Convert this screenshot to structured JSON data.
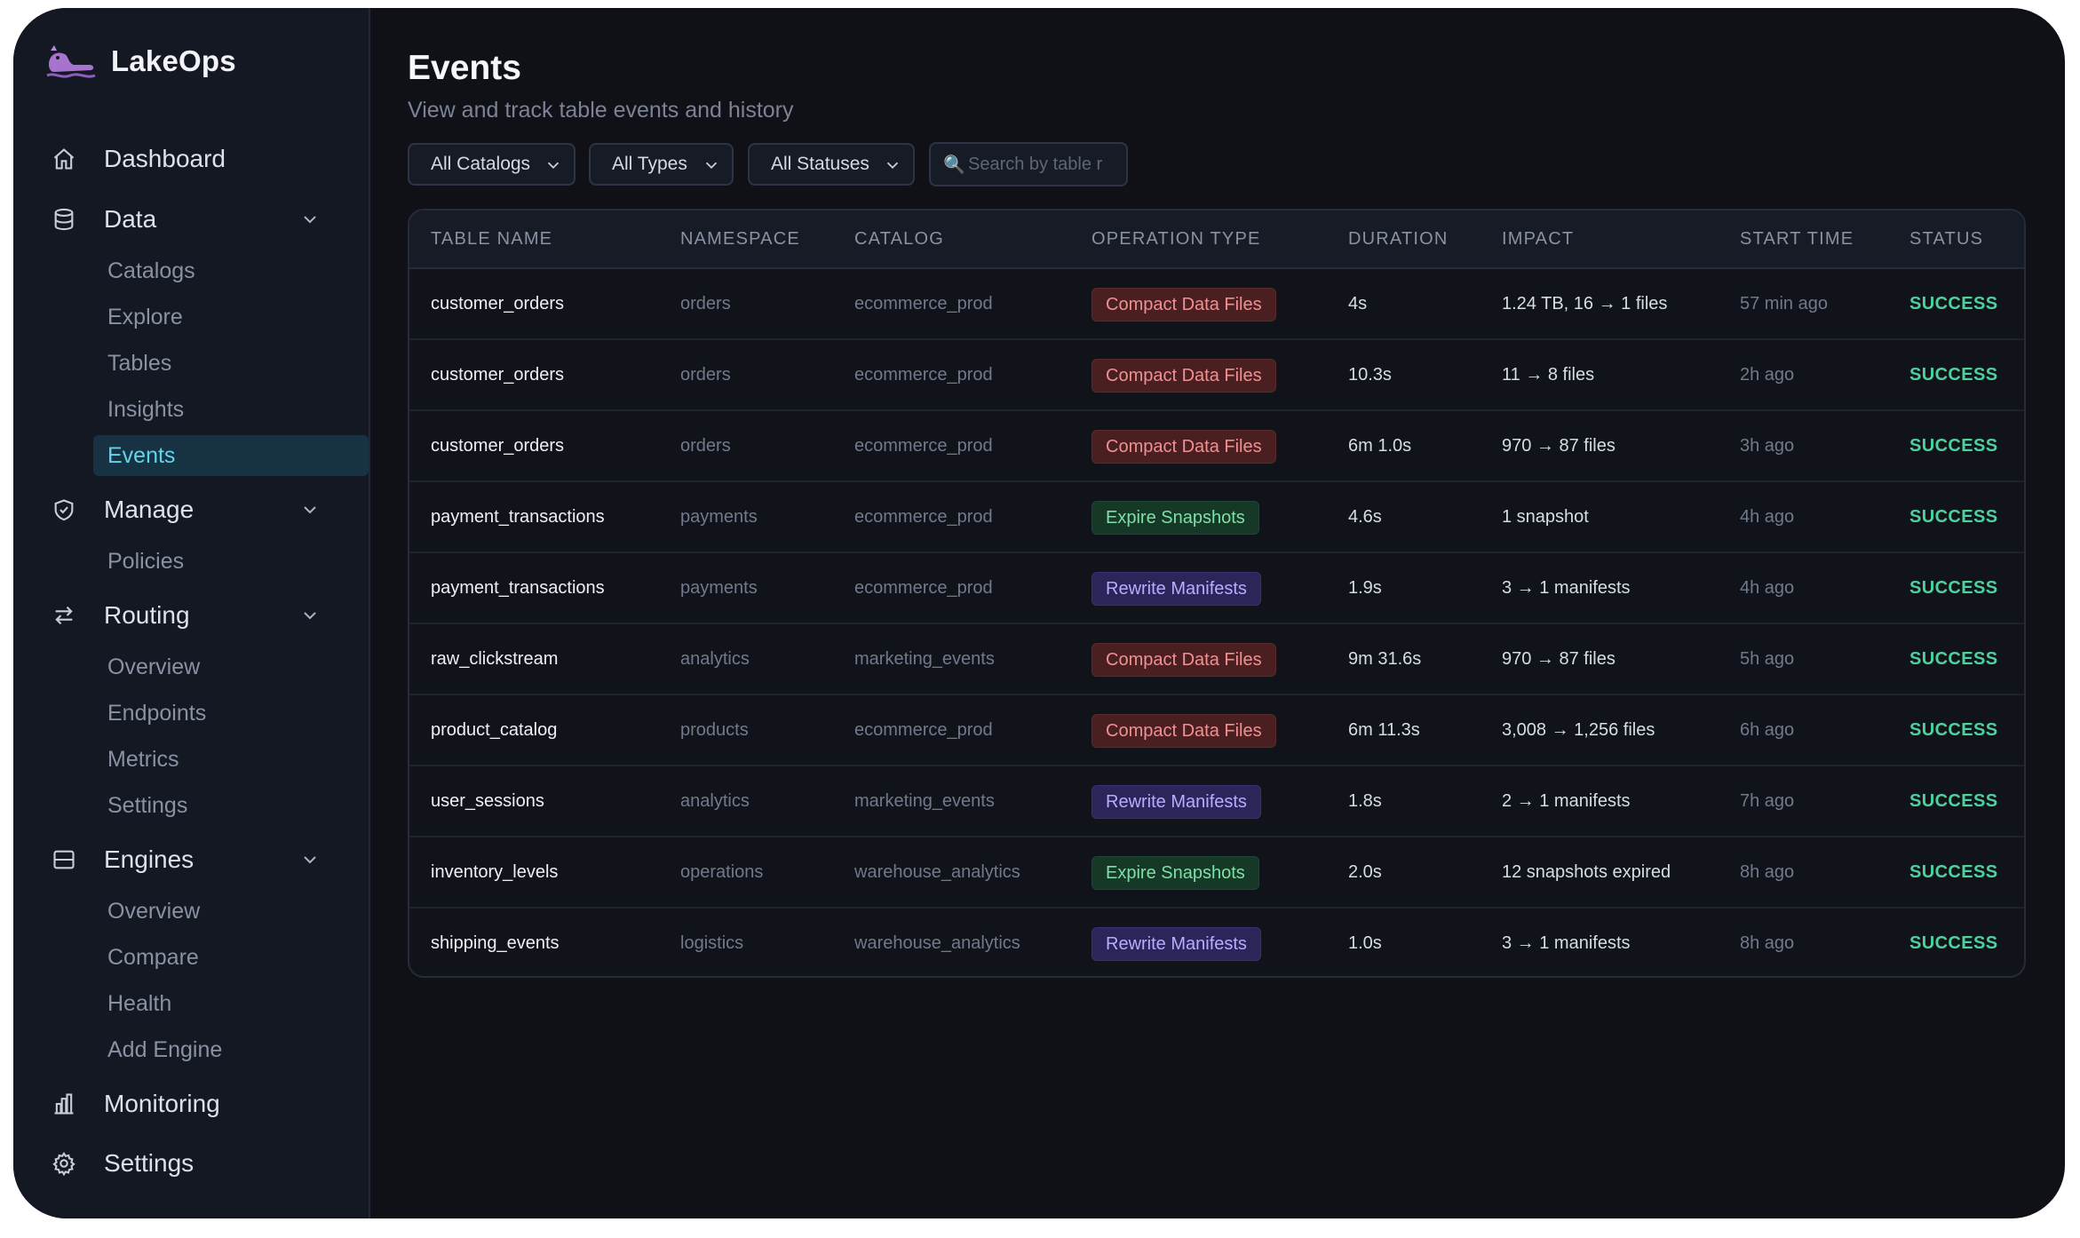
{
  "app": {
    "brand": "LakeOps",
    "page_title": "Events",
    "page_subtitle": "View and track table events and history"
  },
  "sidebar": {
    "top_items": [
      {
        "label": "Dashboard",
        "icon": "home-icon"
      },
      {
        "label": "Data",
        "icon": "database-icon",
        "expanded": true
      },
      {
        "label": "Manage",
        "icon": "shield-icon",
        "expanded": true
      },
      {
        "label": "Routing",
        "icon": "arrows-swap-icon",
        "expanded": true
      },
      {
        "label": "Engines",
        "icon": "server-icon",
        "expanded": true
      },
      {
        "label": "Monitoring",
        "icon": "bar-chart-icon"
      },
      {
        "label": "Settings",
        "icon": "gear-icon"
      }
    ],
    "data_items": [
      "Catalogs",
      "Explore",
      "Tables",
      "Insights",
      "Events"
    ],
    "manage_items": [
      "Policies"
    ],
    "routing_items": [
      "Overview",
      "Endpoints",
      "Metrics",
      "Settings"
    ],
    "engines_items": [
      "Overview",
      "Compare",
      "Health",
      "Add Engine"
    ],
    "active_item": "Events"
  },
  "filters": {
    "catalog": "All Catalogs",
    "type": "All Types",
    "status": "All Statuses",
    "search_placeholder": "Search by table r",
    "search_value": ""
  },
  "table": {
    "columns": [
      "TABLE NAME",
      "NAMESPACE",
      "CATALOG",
      "OPERATION TYPE",
      "DURATION",
      "IMPACT",
      "START TIME",
      "STATUS"
    ],
    "rows": [
      {
        "table": "customer_orders",
        "namespace": "orders",
        "catalog": "ecommerce_prod",
        "operation": "Compact Data Files",
        "op_kind": "compact",
        "duration": "4s",
        "impact": "1.24 TB, 16 → 1 files",
        "start": "57 min ago",
        "status": "SUCCESS"
      },
      {
        "table": "customer_orders",
        "namespace": "orders",
        "catalog": "ecommerce_prod",
        "operation": "Compact Data Files",
        "op_kind": "compact",
        "duration": "10.3s",
        "impact": "11 → 8 files",
        "start": "2h ago",
        "status": "SUCCESS"
      },
      {
        "table": "customer_orders",
        "namespace": "orders",
        "catalog": "ecommerce_prod",
        "operation": "Compact Data Files",
        "op_kind": "compact",
        "duration": "6m 1.0s",
        "impact": "970 → 87 files",
        "start": "3h ago",
        "status": "SUCCESS"
      },
      {
        "table": "payment_transactions",
        "namespace": "payments",
        "catalog": "ecommerce_prod",
        "operation": "Expire Snapshots",
        "op_kind": "expire",
        "duration": "4.6s",
        "impact": "1 snapshot",
        "start": "4h ago",
        "status": "SUCCESS"
      },
      {
        "table": "payment_transactions",
        "namespace": "payments",
        "catalog": "ecommerce_prod",
        "operation": "Rewrite Manifests",
        "op_kind": "rewrite",
        "duration": "1.9s",
        "impact": "3 → 1 manifests",
        "start": "4h ago",
        "status": "SUCCESS"
      },
      {
        "table": "raw_clickstream",
        "namespace": "analytics",
        "catalog": "marketing_events",
        "operation": "Compact Data Files",
        "op_kind": "compact",
        "duration": "9m 31.6s",
        "impact": "970 → 87 files",
        "start": "5h ago",
        "status": "SUCCESS"
      },
      {
        "table": "product_catalog",
        "namespace": "products",
        "catalog": "ecommerce_prod",
        "operation": "Compact Data Files",
        "op_kind": "compact",
        "duration": "6m 11.3s",
        "impact": "3,008 → 1,256 files",
        "start": "6h ago",
        "status": "SUCCESS"
      },
      {
        "table": "user_sessions",
        "namespace": "analytics",
        "catalog": "marketing_events",
        "operation": "Rewrite Manifests",
        "op_kind": "rewrite",
        "duration": "1.8s",
        "impact": "2 → 1 manifests",
        "start": "7h ago",
        "status": "SUCCESS"
      },
      {
        "table": "inventory_levels",
        "namespace": "operations",
        "catalog": "warehouse_analytics",
        "operation": "Expire Snapshots",
        "op_kind": "expire",
        "duration": "2.0s",
        "impact": "12 snapshots expired",
        "start": "8h ago",
        "status": "SUCCESS"
      },
      {
        "table": "shipping_events",
        "namespace": "logistics",
        "catalog": "warehouse_analytics",
        "operation": "Rewrite Manifests",
        "op_kind": "rewrite",
        "duration": "1.0s",
        "impact": "3 → 1 manifests",
        "start": "8h ago",
        "status": "SUCCESS"
      }
    ]
  },
  "colors": {
    "background": "#0f1117",
    "sidebar": "#141823",
    "accent": "#63d3e9",
    "success": "#4ed19a",
    "compact_badge": "#4a1f22",
    "expire_badge": "#163827",
    "rewrite_badge": "#2c2559"
  }
}
